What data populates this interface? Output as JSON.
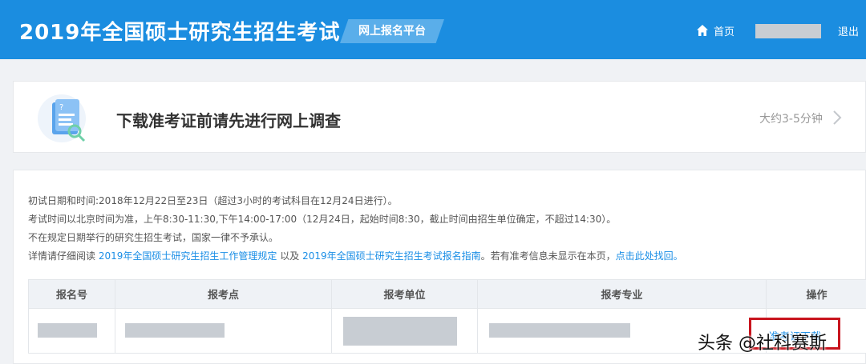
{
  "header": {
    "title": "2019年全国硕士研究生招生考试",
    "platform": "网上报名平台",
    "home": "首页",
    "logout": "退出"
  },
  "survey": {
    "title": "下载准考证前请先进行网上调查",
    "duration": "大约3-5分钟"
  },
  "notice": {
    "line1": "初试日期和时间:2018年12月22日至23日（超过3小时的考试科目在12月24日进行）。",
    "line2": "考试时间以北京时间为准，上午8:30-11:30,下午14:00-17:00（12月24日，起始时间8:30，截止时间由招生单位确定，不超过14:30）。",
    "line3": "不在规定日期举行的研究生招生考试，国家一律不予承认。",
    "line4_prefix": "详情请仔细阅读",
    "link_rules": "2019年全国硕士研究生招生工作管理规定",
    "line4_mid": "以及",
    "link_guide": "2019年全国硕士研究生招生考试报名指南",
    "line4_suffix": "。若有准考信息未显示在本页，",
    "link_recover": "点击此处找回。"
  },
  "table": {
    "columns": [
      "报名号",
      "报考点",
      "报考单位",
      "报考专业",
      "操作"
    ],
    "row_action": "准考证下载"
  },
  "watermark": "头条 @社科赛斯",
  "colors": {
    "header_bg": "#1b8de0",
    "link": "#1a8ee6",
    "highlight_border": "#c8141e"
  }
}
